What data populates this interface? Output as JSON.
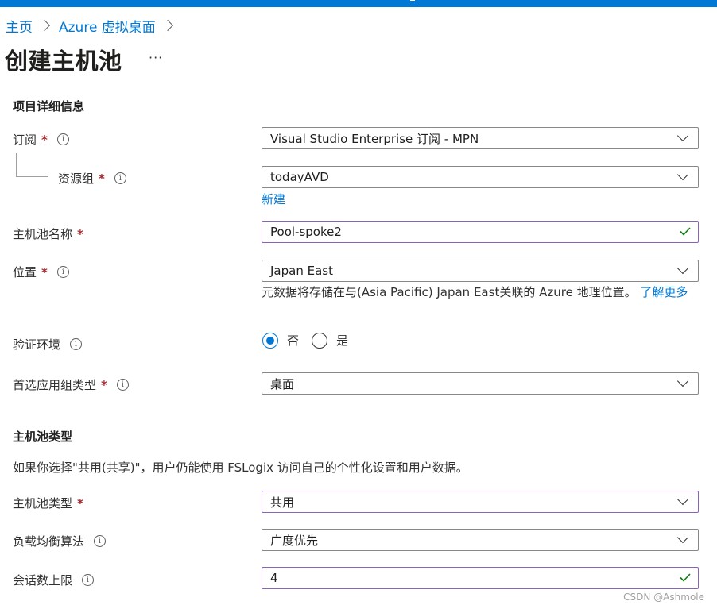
{
  "breadcrumb": {
    "home": "主页",
    "parent": "Azure 虚拟桌面"
  },
  "page": {
    "title": "创建主机池",
    "more": "···"
  },
  "project_details": {
    "heading": "项目详细信息",
    "subscription": {
      "label": "订阅",
      "value": "Visual Studio Enterprise 订阅 - MPN"
    },
    "resource_group": {
      "label": "资源组",
      "value": "todayAVD",
      "new_link": "新建"
    }
  },
  "pool_name": {
    "label": "主机池名称",
    "value": "Pool-spoke2"
  },
  "location": {
    "label": "位置",
    "value": "Japan East",
    "help": "元数据将存储在与(Asia Pacific) Japan East关联的 Azure 地理位置。",
    "learn_more": "了解更多"
  },
  "validation_env": {
    "label": "验证环境",
    "options": [
      "否",
      "是"
    ],
    "selected": "否"
  },
  "preferred_app_group": {
    "label": "首选应用组类型",
    "value": "桌面"
  },
  "pool_type_section": {
    "heading": "主机池类型",
    "description": "如果你选择\"共用(共享)\"，用户仍能使用 FSLogix 访问自己的个性化设置和用户数据。",
    "pool_type": {
      "label": "主机池类型",
      "value": "共用"
    },
    "load_balancing": {
      "label": "负载均衡算法",
      "value": "广度优先"
    },
    "session_limit": {
      "label": "会话数上限",
      "value": "4"
    }
  },
  "required_mark": "*",
  "info_glyph": "i",
  "watermark": "CSDN @Ashmole",
  "colors": {
    "accent": "#0078d4",
    "required": "#a4262c",
    "valid_border": "#8764b8",
    "valid_check": "#107c10"
  }
}
